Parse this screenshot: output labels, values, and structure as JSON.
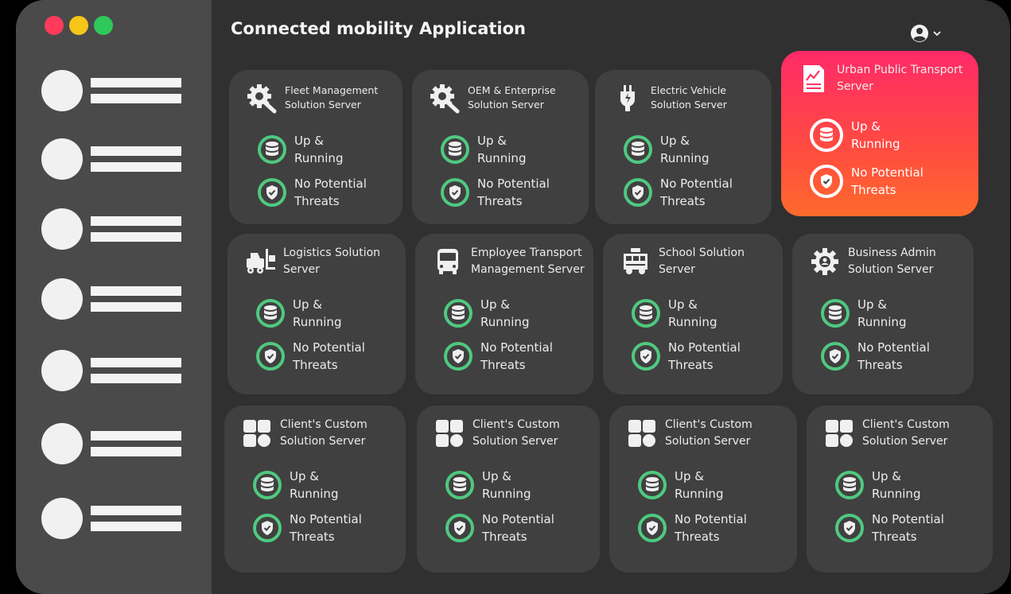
{
  "app": {
    "title": "Connected mobility Application",
    "window_dot_colors": [
      "#ff3b5c",
      "#f5c518",
      "#2fc85a"
    ],
    "accent_ok": "#4fc97f",
    "highlight_gradient": [
      "#ff2a68",
      "#ff6a2c"
    ]
  },
  "sidebar": {
    "item_count": 7,
    "icon": "avatar-placeholder"
  },
  "header": {
    "user_icon": "user-circle-icon",
    "menu_icon": "chevron-down-icon"
  },
  "status_labels": {
    "running": "Up & Running",
    "threats": "No Potential Threats"
  },
  "cards": [
    {
      "title": "Fleet Management Solution Server",
      "icon": "gear-wrench-icon",
      "highlight": false
    },
    {
      "title": "OEM & Enterprise Solution Server",
      "icon": "gear-wrench-icon",
      "highlight": false
    },
    {
      "title": "Electric Vehicle Solution Server",
      "icon": "ev-plug-icon",
      "highlight": false
    },
    {
      "title": "Urban Public Transport Server",
      "icon": "document-chart-icon",
      "highlight": true
    },
    {
      "title": "Logistics Solution Server",
      "icon": "forklift-icon",
      "highlight": false
    },
    {
      "title": "Employee Transport Management Server",
      "icon": "bus-icon",
      "highlight": false
    },
    {
      "title": "School Solution Server",
      "icon": "school-bus-icon",
      "highlight": false
    },
    {
      "title": "Business Admin Solution Server",
      "icon": "gear-user-icon",
      "highlight": false
    },
    {
      "title": "Client's Custom Solution Server",
      "icon": "grid-shapes-icon",
      "highlight": false
    },
    {
      "title": "Client's Custom Solution Server",
      "icon": "grid-shapes-icon",
      "highlight": false
    },
    {
      "title": "Client's Custom Solution Server",
      "icon": "grid-shapes-icon",
      "highlight": false
    },
    {
      "title": "Client's Custom Solution Server",
      "icon": "grid-shapes-icon",
      "highlight": false
    }
  ]
}
